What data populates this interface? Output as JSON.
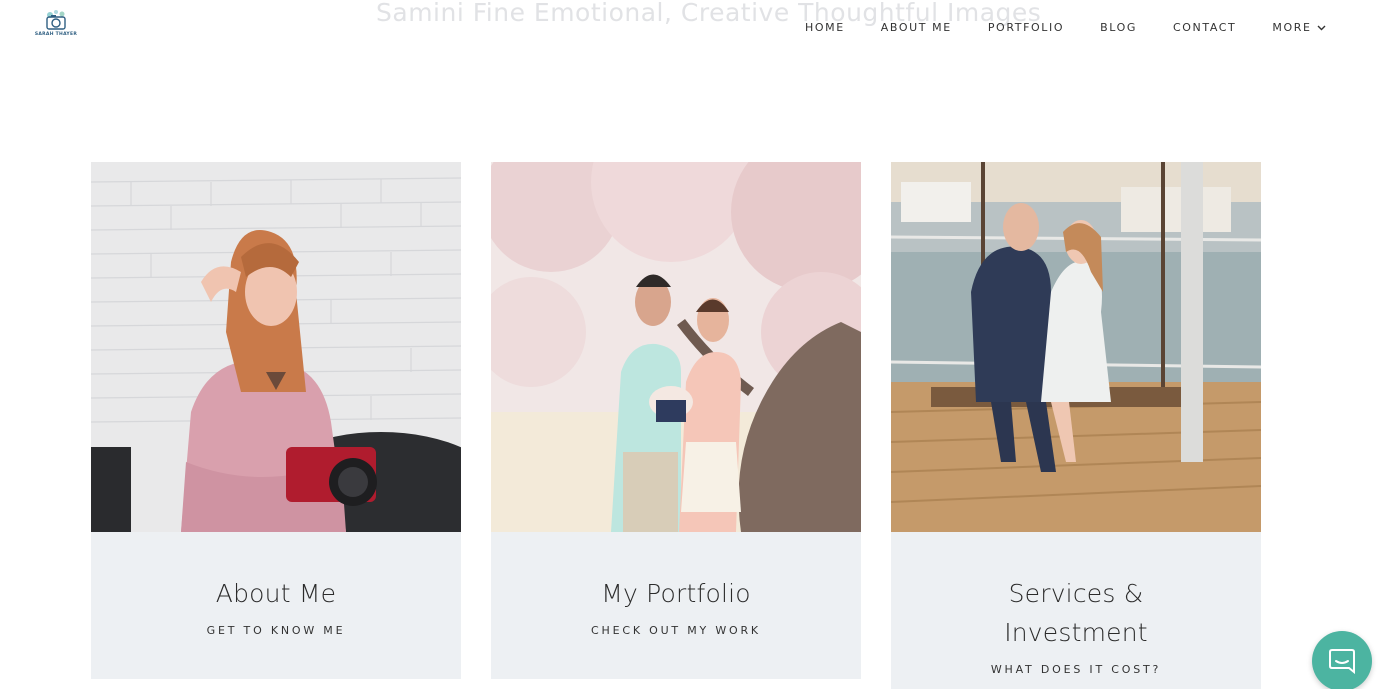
{
  "ghost_heading": "Samini Fine Emotional, Creative Thoughtful Images",
  "logo": {
    "text": "SARAH THAYER"
  },
  "nav": {
    "items": [
      "HOME",
      "ABOUT ME",
      "PORTFOLIO",
      "BLOG",
      "CONTACT"
    ],
    "more_label": "MORE"
  },
  "cards": [
    {
      "title": "About Me",
      "subtitle": "GET TO KNOW ME"
    },
    {
      "title": "My Portfolio",
      "subtitle": "CHECK OUT MY WORK"
    },
    {
      "title": "Services & Investment",
      "subtitle": "WHAT DOES IT COST?"
    }
  ],
  "colors": {
    "card_bg": "#edf0f3",
    "chat_accent": "#4cb4a1",
    "logo_blue": "#2f5f82"
  },
  "icons": {
    "more": "chevron-down-icon",
    "chat": "chat-bubble-icon"
  }
}
